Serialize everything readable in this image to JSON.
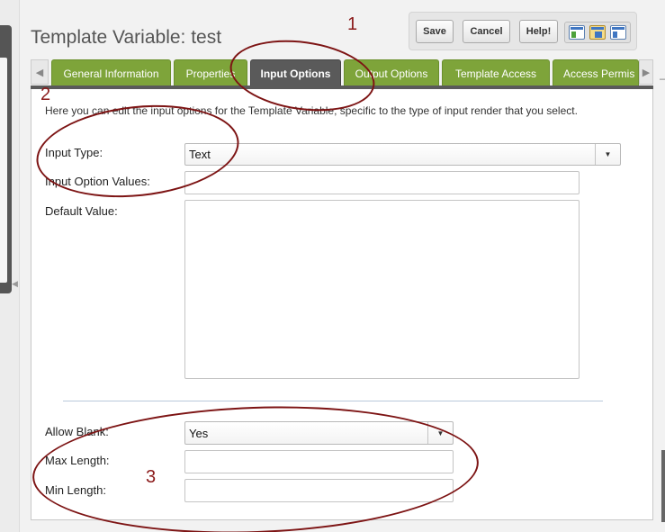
{
  "window": {
    "title": "Template Variable: test"
  },
  "toolbar": {
    "save_label": "Save",
    "cancel_label": "Cancel",
    "help_label": "Help!",
    "view_icons": [
      "layout-left-icon",
      "layout-center-icon",
      "layout-right-icon"
    ]
  },
  "tabs": [
    {
      "label": "General Information",
      "active": false
    },
    {
      "label": "Properties",
      "active": false
    },
    {
      "label": "Input Options",
      "active": true
    },
    {
      "label": "Output Options",
      "active": false
    },
    {
      "label": "Template Access",
      "active": false
    },
    {
      "label": "Access Permis",
      "active": false
    }
  ],
  "form": {
    "intro": "Here you can edit the input options for the Template Variable, specific to the type of input render that you select.",
    "input_type": {
      "label": "Input Type:",
      "value": "Text"
    },
    "input_option_values": {
      "label": "Input Option Values:",
      "value": ""
    },
    "default_value": {
      "label": "Default Value:",
      "value": ""
    },
    "allow_blank": {
      "label": "Allow Blank:",
      "value": "Yes"
    },
    "max_length": {
      "label": "Max Length:",
      "value": ""
    },
    "min_length": {
      "label": "Min Length:",
      "value": ""
    }
  },
  "annotations": {
    "one": "1",
    "two": "2",
    "three": "3"
  },
  "colors": {
    "tab_green": "#7ea43a",
    "tab_active": "#5a5a5a",
    "annotation_red": "#7d1414"
  }
}
